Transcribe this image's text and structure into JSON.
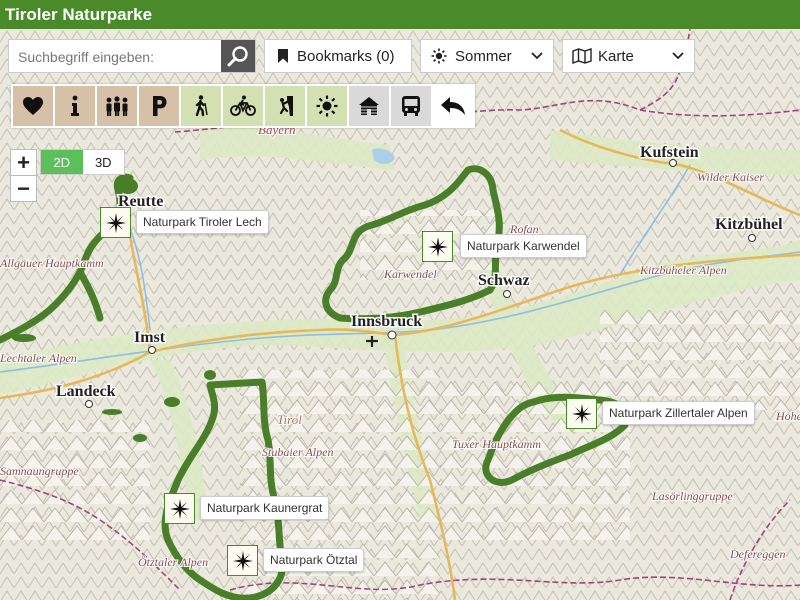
{
  "app_title": "Tiroler Naturparke",
  "search": {
    "placeholder": "Suchbegriff eingeben:"
  },
  "icons": {
    "search": "search-icon",
    "bookmark": "bookmark-icon",
    "season": "sun-icon",
    "map_type": "map-icon",
    "chevron": "chevron-down-icon"
  },
  "bookmarks": {
    "label": "Bookmarks (0)"
  },
  "season": {
    "selected": "Sommer"
  },
  "map_type": {
    "selected": "Karte"
  },
  "toolbar": [
    {
      "name": "favorites",
      "icon": "heart-icon",
      "bg": "#d7c0a8"
    },
    {
      "name": "info",
      "icon": "info-icon",
      "bg": "#d7c0a8"
    },
    {
      "name": "groups",
      "icon": "people-icon",
      "bg": "#d7c0a8"
    },
    {
      "name": "parking",
      "icon": "parking-icon",
      "bg": "#d7c0a8"
    },
    {
      "name": "hiking",
      "icon": "hiker-icon",
      "bg": "#d2e0b2"
    },
    {
      "name": "cycling",
      "icon": "bike-icon",
      "bg": "#d2e0b2"
    },
    {
      "name": "climbing",
      "icon": "climbing-icon",
      "bg": "#d2e0b2"
    },
    {
      "name": "summer",
      "icon": "sun-icon",
      "bg": "#d2e0b2"
    },
    {
      "name": "huts",
      "icon": "hut-icon",
      "bg": "#d9d9d9"
    },
    {
      "name": "bus",
      "icon": "bus-icon",
      "bg": "#d9d9d9"
    },
    {
      "name": "back",
      "icon": "back-arrow-icon",
      "bg": "#ffffff"
    }
  ],
  "zoom": {
    "in": "+",
    "out": "−"
  },
  "view_mode": {
    "two_d": "2D",
    "three_d": "3D",
    "active": "2D"
  },
  "parks": [
    {
      "name": "Naturpark Tiroler Lech"
    },
    {
      "name": "Naturpark Karwendel"
    },
    {
      "name": "Naturpark Zillertaler Alpen"
    },
    {
      "name": "Naturpark Kaunergrat"
    },
    {
      "name": "Naturpark Ötztal"
    }
  ],
  "towns": [
    {
      "name": "Kufstein"
    },
    {
      "name": "Kitzbühel"
    },
    {
      "name": "Reutte"
    },
    {
      "name": "Schwaz"
    },
    {
      "name": "Innsbruck"
    },
    {
      "name": "Imst"
    },
    {
      "name": "Landeck"
    }
  ],
  "regions": [
    {
      "name": "Bayern"
    },
    {
      "name": "Wilder Kaiser"
    },
    {
      "name": "Rofan"
    },
    {
      "name": "Karwendel"
    },
    {
      "name": "Kitzbüheler Alpen"
    },
    {
      "name": "Allgäuer Hauptkamm"
    },
    {
      "name": "Lechtaler Alpen"
    },
    {
      "name": "Tirol"
    },
    {
      "name": "Stubaier Alpen"
    },
    {
      "name": "Tuxer Hauptkamm"
    },
    {
      "name": "Samnaungruppe"
    },
    {
      "name": "Ötztaler Alpen"
    },
    {
      "name": "Lasörlinggruppe"
    },
    {
      "name": "Defereggen"
    },
    {
      "name": "Hohe"
    }
  ],
  "colors": {
    "brand": "#4a8a2a",
    "park_boundary": "#4a7f2a",
    "border": "#a0457a",
    "road": "#e6b85a"
  }
}
